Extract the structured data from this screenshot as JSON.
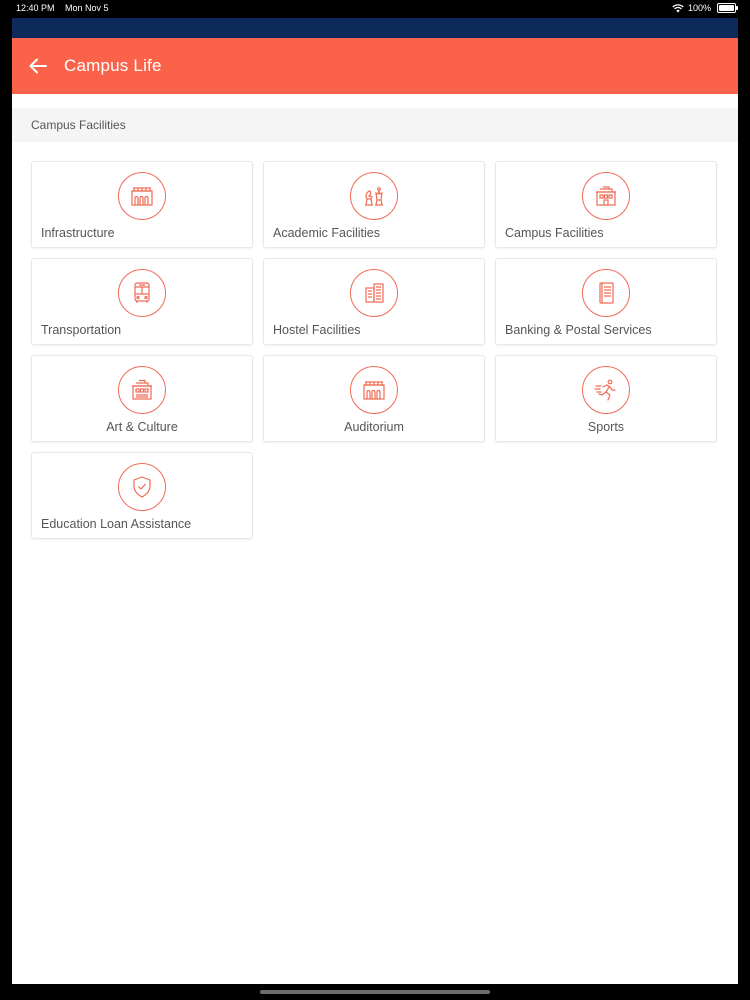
{
  "status": {
    "time": "12:40 PM",
    "date": "Mon Nov 5",
    "battery": "100%"
  },
  "header": {
    "title": "Campus Life"
  },
  "section": {
    "title": "Campus Facilities"
  },
  "colors": {
    "accent": "#fb624a",
    "navy": "#0d2a5a",
    "icon": "#ef6c55"
  },
  "tiles": [
    {
      "label": "Infrastructure",
      "icon": "building-icon"
    },
    {
      "label": "Academic Facilities",
      "icon": "chess-icon"
    },
    {
      "label": "Campus Facilities",
      "icon": "school-building-icon"
    },
    {
      "label": "Transportation",
      "icon": "bus-icon"
    },
    {
      "label": "Hostel Facilities",
      "icon": "apartment-icon"
    },
    {
      "label": "Banking & Postal Services",
      "icon": "ledger-icon"
    },
    {
      "label": "Art & Culture",
      "icon": "museum-icon"
    },
    {
      "label": "Auditorium",
      "icon": "auditorium-icon"
    },
    {
      "label": "Sports",
      "icon": "runner-icon"
    },
    {
      "label": "Education Loan Assistance",
      "icon": "shield-check-icon"
    }
  ]
}
